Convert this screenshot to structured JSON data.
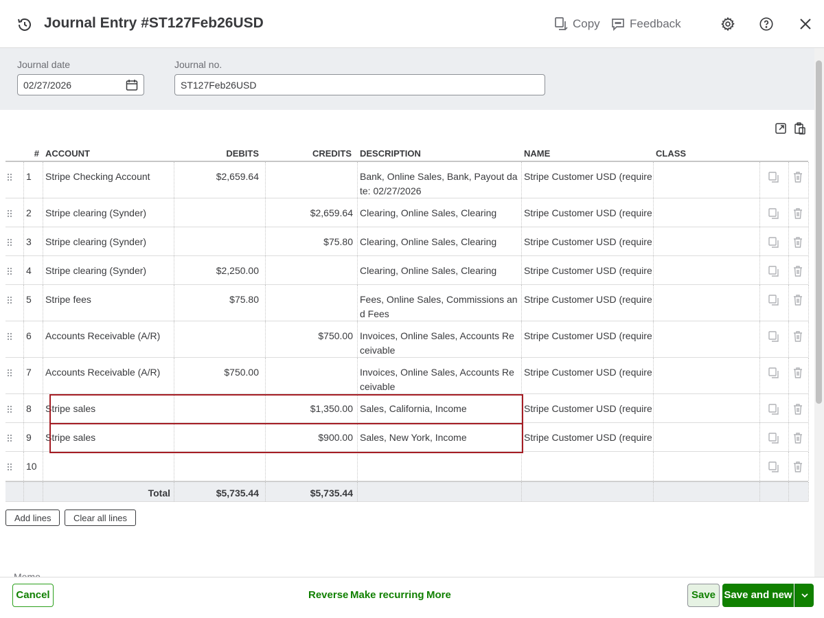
{
  "header": {
    "title": "Journal Entry #ST127Feb26USD",
    "copy_label": "Copy",
    "feedback_label": "Feedback"
  },
  "form": {
    "journal_date_label": "Journal date",
    "journal_date_value": "02/27/2026",
    "journal_no_label": "Journal no.",
    "journal_no_value": "ST127Feb26USD"
  },
  "table": {
    "columns": [
      "#",
      "ACCOUNT",
      "DEBITS",
      "CREDITS",
      "DESCRIPTION",
      "NAME",
      "CLASS"
    ],
    "rows": [
      {
        "num": "1",
        "account": "Stripe Checking Account",
        "debit": "$2,659.64",
        "credit": "",
        "description": "Bank, Online Sales, Bank, Payout date: 02/27/2026",
        "name": "Stripe Customer USD (required)",
        "class": ""
      },
      {
        "num": "2",
        "account": "Stripe clearing (Synder)",
        "debit": "",
        "credit": "$2,659.64",
        "description": "Clearing, Online Sales, Clearing",
        "name": "Stripe Customer USD (required)",
        "class": ""
      },
      {
        "num": "3",
        "account": "Stripe clearing (Synder)",
        "debit": "",
        "credit": "$75.80",
        "description": "Clearing, Online Sales, Clearing",
        "name": "Stripe Customer USD (required)",
        "class": ""
      },
      {
        "num": "4",
        "account": "Stripe clearing (Synder)",
        "debit": "$2,250.00",
        "credit": "",
        "description": "Clearing, Online Sales, Clearing",
        "name": "Stripe Customer USD (required)",
        "class": ""
      },
      {
        "num": "5",
        "account": "Stripe fees",
        "debit": "$75.80",
        "credit": "",
        "description": "Fees, Online Sales, Commissions and Fees",
        "name": "Stripe Customer USD (required)",
        "class": ""
      },
      {
        "num": "6",
        "account": "Accounts Receivable (A/R)",
        "debit": "",
        "credit": "$750.00",
        "description": "Invoices, Online Sales, Accounts Receivable",
        "name": "Stripe Customer USD (required)",
        "class": ""
      },
      {
        "num": "7",
        "account": "Accounts Receivable (A/R)",
        "debit": "$750.00",
        "credit": "",
        "description": "Invoices, Online Sales, Accounts Receivable",
        "name": "Stripe Customer USD (required)",
        "class": ""
      },
      {
        "num": "8",
        "account": "Stripe sales",
        "debit": "",
        "credit": "$1,350.00",
        "description": "Sales, California, Income",
        "name": "Stripe Customer USD (required)",
        "class": ""
      },
      {
        "num": "9",
        "account": "Stripe sales",
        "debit": "",
        "credit": "$900.00",
        "description": "Sales, New York, Income",
        "name": "Stripe Customer USD (required)",
        "class": ""
      },
      {
        "num": "10",
        "account": "",
        "debit": "",
        "credit": "",
        "description": "",
        "name": "",
        "class": ""
      }
    ],
    "total_label": "Total",
    "total_debits": "$5,735.44",
    "total_credits": "$5,735.44"
  },
  "buttons": {
    "add_lines": "Add lines",
    "clear_all_lines": "Clear all lines"
  },
  "memo_label": "Memo",
  "footer": {
    "cancel": "Cancel",
    "reverse": "Reverse",
    "make_recurring": "Make recurring",
    "more": "More",
    "save": "Save",
    "save_and_new": "Save and new"
  },
  "colors": {
    "accent_green": "#108000",
    "highlight_red": "#a51d24"
  }
}
